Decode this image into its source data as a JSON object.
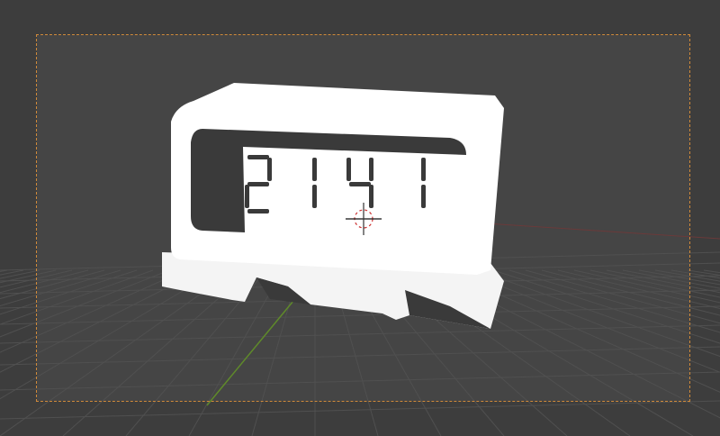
{
  "viewport": {
    "background_color": "#3d3d3d",
    "camera_area_color": "#454545",
    "camera_frame_color": "#d08a3a",
    "x_axis_color": "#8a3b3b",
    "y_axis_color": "#5f8a2a"
  },
  "model": {
    "name": "alarm clock",
    "display_digits": "2141",
    "body_color": "#ffffff",
    "screen_color": "#3a3a3a"
  }
}
